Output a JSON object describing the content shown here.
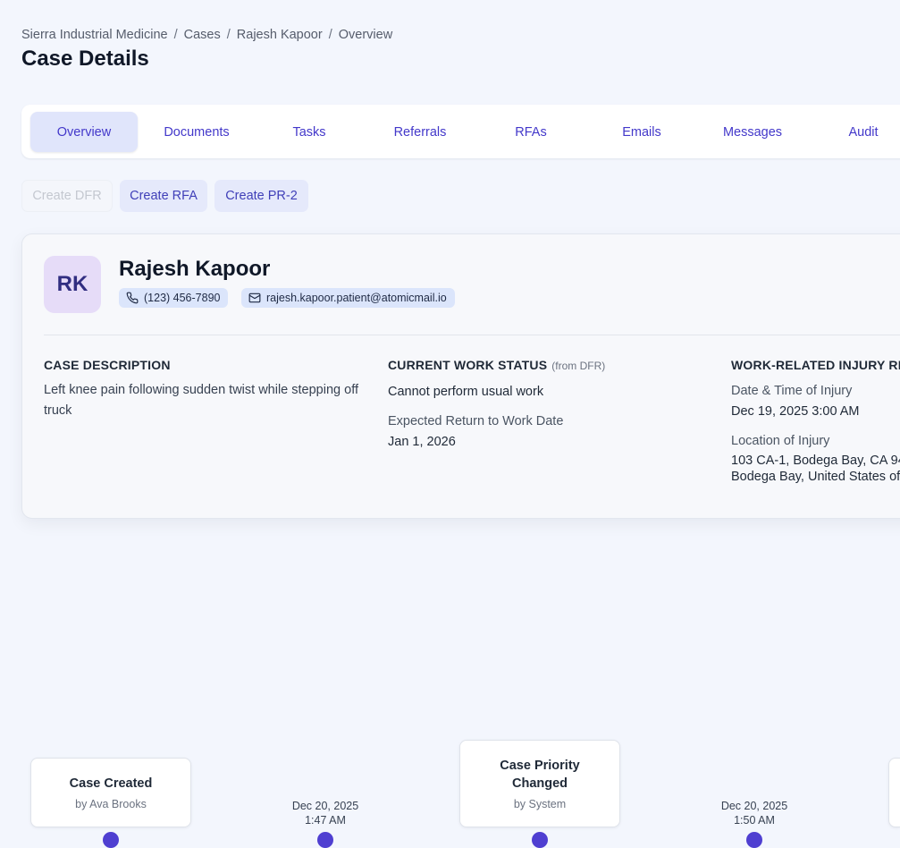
{
  "breadcrumb": [
    "Sierra Industrial Medicine",
    "Cases",
    "Rajesh Kapoor",
    "Overview"
  ],
  "page_title": "Case Details",
  "tabs": [
    "Overview",
    "Documents",
    "Tasks",
    "Referrals",
    "RFAs",
    "Emails",
    "Messages",
    "Audit"
  ],
  "active_tab": "Overview",
  "actions": {
    "create_dfr": "Create DFR",
    "create_rfa": "Create RFA",
    "create_pr2": "Create PR-2"
  },
  "patient": {
    "initials": "RK",
    "name": "Rajesh Kapoor",
    "phone": "(123) 456-7890",
    "email": "rajesh.kapoor.patient@atomicmail.io"
  },
  "case_description": {
    "title": "CASE DESCRIPTION",
    "text": "Left knee pain following sudden twist while stepping off truck"
  },
  "work_status": {
    "title": "CURRENT WORK STATUS",
    "subtitle": "(from DFR)",
    "status": "Cannot perform usual work",
    "return_label": "Expected Return to Work Date",
    "return_value": "Jan 1, 2026"
  },
  "injury": {
    "title": "WORK-RELATED INJURY RE",
    "datetime_label": "Date & Time of Injury",
    "datetime_value": "Dec 19, 2025 3:00 AM",
    "location_label": "Location of Injury",
    "location_line1": "103 CA-1, Bodega Bay, CA 94",
    "location_line2": "Bodega Bay, United States of"
  },
  "timeline": {
    "events": [
      {
        "title": "Case Created",
        "by": "by Ava Brooks"
      },
      {
        "title": "Case Priority Changed",
        "by": "by System"
      }
    ],
    "dates": [
      {
        "date": "Dec 20, 2025",
        "time": "1:47 AM"
      },
      {
        "date": "Dec 20, 2025",
        "time": "1:50 AM"
      }
    ]
  },
  "colors": {
    "accent": "#4338ca",
    "active_tab_bg": "#e0e5fb",
    "avatar_bg": "#e6dcf8",
    "chip_bg": "#dbe5fb",
    "timeline_dot": "#4f3fd1",
    "page_bg": "#f3f6fd"
  },
  "icons": {
    "phone": "phone-icon",
    "email": "mail-icon"
  }
}
